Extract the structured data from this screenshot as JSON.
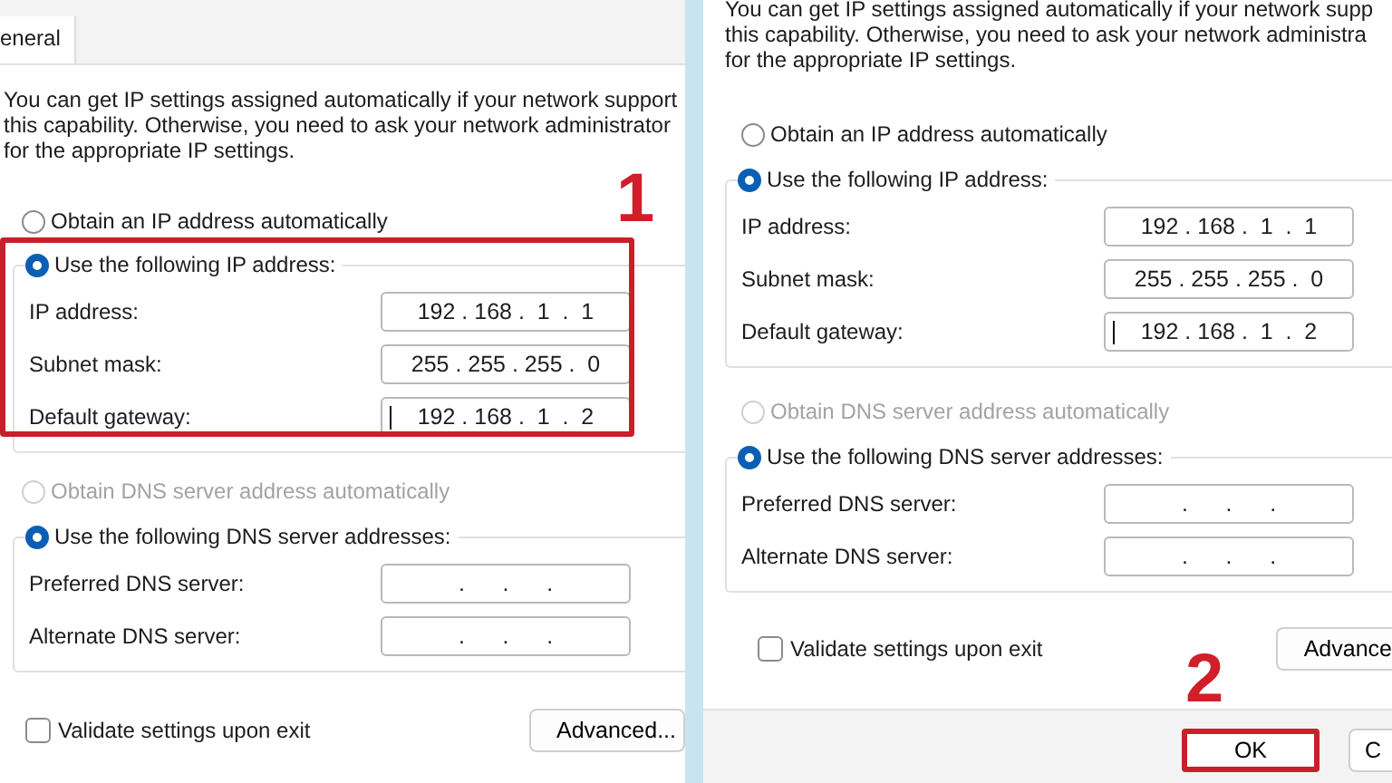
{
  "panels": [
    {
      "tab": "eneral",
      "intro": [
        "You can get IP settings assigned automatically if your network support",
        "this capability. Otherwise, you need to ask your network administrator",
        "for the appropriate IP settings."
      ],
      "ip_options": [
        {
          "label": "Obtain an IP address automatically",
          "selected": false,
          "disabled": false
        },
        {
          "label": "Use the following IP address:",
          "selected": true,
          "disabled": false
        }
      ],
      "ip_fields": [
        {
          "label": "IP address:",
          "value": "192 . 168 .  1  .  1",
          "caret": false
        },
        {
          "label": "Subnet mask:",
          "value": "255 . 255 . 255 .  0",
          "caret": false
        },
        {
          "label": "Default gateway:",
          "value": "192 . 168 .  1  .  2",
          "caret": true
        }
      ],
      "ip_group_highlighted": true,
      "dns_options": [
        {
          "label": "Obtain DNS server address automatically",
          "selected": false,
          "disabled": true
        },
        {
          "label": "Use the following DNS server addresses:",
          "selected": true,
          "disabled": false
        }
      ],
      "dns_fields": [
        {
          "label": "Preferred DNS server:",
          "value": ".      .      .",
          "caret": false
        },
        {
          "label": "Alternate DNS server:",
          "value": ".      .      .",
          "caret": false
        }
      ],
      "validate": {
        "label": "Validate settings upon exit",
        "checked": false
      },
      "advanced_button": "Advanced...",
      "ip_group_step_number": "1"
    },
    {
      "intro": [
        "You can get IP settings assigned automatically if your network supp",
        "this capability. Otherwise, you need to ask your network administra",
        "for the appropriate IP settings."
      ],
      "ip_options": [
        {
          "label": "Obtain an IP address automatically",
          "selected": false,
          "disabled": false
        },
        {
          "label": "Use the following IP address:",
          "selected": true,
          "disabled": false
        }
      ],
      "ip_fields": [
        {
          "label": "IP address:",
          "value": "192 . 168 .  1  .  1",
          "caret": false
        },
        {
          "label": "Subnet mask:",
          "value": "255 . 255 . 255 .  0",
          "caret": false
        },
        {
          "label": "Default gateway:",
          "value": "192 . 168 .  1  .  2",
          "caret": true
        }
      ],
      "ip_group_highlighted": false,
      "dns_options": [
        {
          "label": "Obtain DNS server address automatically",
          "selected": false,
          "disabled": true
        },
        {
          "label": "Use the following DNS server addresses:",
          "selected": true,
          "disabled": false
        }
      ],
      "dns_fields": [
        {
          "label": "Preferred DNS server:",
          "value": ".      .      .",
          "caret": false
        },
        {
          "label": "Alternate DNS server:",
          "value": ".      .      .",
          "caret": false
        }
      ],
      "validate": {
        "label": "Validate settings upon exit",
        "checked": false
      },
      "advanced_button": "Advance",
      "dialog_buttons": [
        {
          "label": "OK",
          "highlighted": true,
          "step_number": "2"
        },
        {
          "label": "C",
          "highlighted": false
        }
      ]
    }
  ]
}
